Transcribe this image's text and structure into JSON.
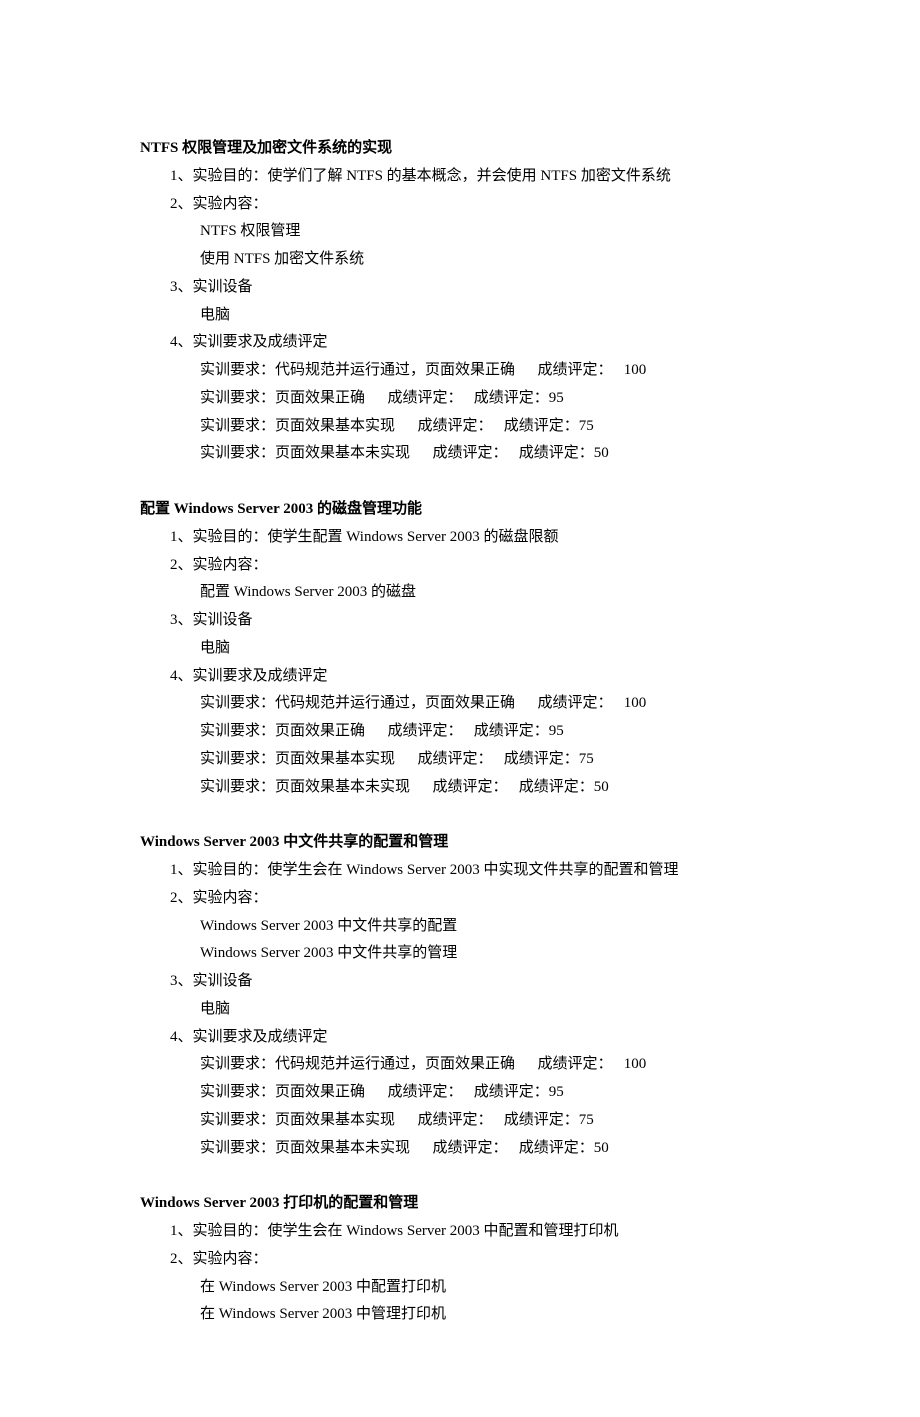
{
  "sections": [
    {
      "title": "NTFS 权限管理及加密文件系统的实现",
      "items": [
        {
          "label": "1、实验目的：使学们了解 NTFS 的基本概念，并会使用 NTFS 加密文件系统"
        },
        {
          "label": "2、实验内容：",
          "subs": [
            "NTFS 权限管理",
            "使用 NTFS 加密文件系统"
          ]
        },
        {
          "label": "3、实训设备",
          "subs": [
            "电脑"
          ]
        },
        {
          "label": "4、实训要求及成绩评定",
          "grades": [
            "实训要求：代码规范并运行通过，页面效果正确      成绩评定：   100",
            "实训要求：页面效果正确      成绩评定：   成绩评定：95",
            "实训要求：页面效果基本实现      成绩评定：   成绩评定：75",
            "实训要求：页面效果基本未实现      成绩评定：   成绩评定：50"
          ]
        }
      ]
    },
    {
      "title": "配置 Windows Server 2003 的磁盘管理功能",
      "items": [
        {
          "label": "1、实验目的：使学生配置 Windows Server 2003 的磁盘限额"
        },
        {
          "label": "2、实验内容：",
          "subs": [
            "配置 Windows Server 2003 的磁盘"
          ]
        },
        {
          "label": "3、实训设备",
          "subs": [
            "电脑"
          ]
        },
        {
          "label": "4、实训要求及成绩评定",
          "grades": [
            "实训要求：代码规范并运行通过，页面效果正确      成绩评定：   100",
            "实训要求：页面效果正确      成绩评定：   成绩评定：95",
            "实训要求：页面效果基本实现      成绩评定：   成绩评定：75",
            "实训要求：页面效果基本未实现      成绩评定：   成绩评定：50"
          ]
        }
      ]
    },
    {
      "title": "Windows Server 2003 中文件共享的配置和管理",
      "items": [
        {
          "label": "1、实验目的：使学生会在 Windows Server 2003 中实现文件共享的配置和管理"
        },
        {
          "label": "2、实验内容：",
          "subs": [
            "Windows Server 2003 中文件共享的配置",
            "Windows Server 2003 中文件共享的管理"
          ]
        },
        {
          "label": "3、实训设备",
          "subs": [
            "电脑"
          ]
        },
        {
          "label": "4、实训要求及成绩评定",
          "grades": [
            "实训要求：代码规范并运行通过，页面效果正确      成绩评定：   100",
            "实训要求：页面效果正确      成绩评定：   成绩评定：95",
            "实训要求：页面效果基本实现      成绩评定：   成绩评定：75",
            "实训要求：页面效果基本未实现      成绩评定：   成绩评定：50"
          ]
        }
      ]
    },
    {
      "title": "Windows Server 2003 打印机的配置和管理",
      "items": [
        {
          "label": "1、实验目的：使学生会在 Windows Server 2003 中配置和管理打印机"
        },
        {
          "label": "2、实验内容：",
          "subs": [
            "在 Windows Server 2003 中配置打印机",
            "在 Windows Server 2003 中管理打印机"
          ]
        }
      ]
    }
  ]
}
